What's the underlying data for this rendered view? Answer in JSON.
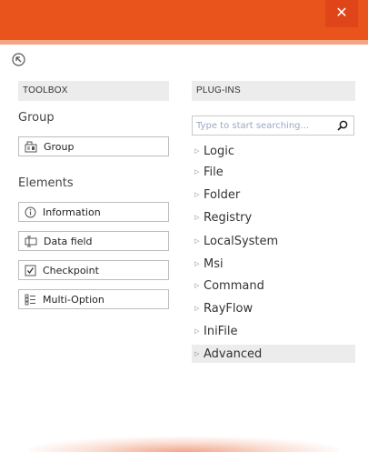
{
  "window": {
    "close_glyph": "✕",
    "accent": "#e8541c"
  },
  "toolbox": {
    "header": "TOOLBOX",
    "group_section_label": "Group",
    "group_items": [
      {
        "label": "Group",
        "icon": "group-icon"
      }
    ],
    "elements_section_label": "Elements",
    "element_items": [
      {
        "label": "Information",
        "icon": "info-icon"
      },
      {
        "label": "Data field",
        "icon": "data-field-icon"
      },
      {
        "label": "Checkpoint",
        "icon": "checkpoint-icon"
      },
      {
        "label": "Multi-Option",
        "icon": "multi-option-icon"
      }
    ]
  },
  "plugins": {
    "header": "PLUG-INS",
    "search_placeholder": "Type to start searching...",
    "items": [
      {
        "label": "Logic"
      },
      {
        "label": "File"
      },
      {
        "label": "Folder"
      },
      {
        "label": "Registry"
      },
      {
        "label": "LocalSystem"
      },
      {
        "label": "Msi"
      },
      {
        "label": "Command"
      },
      {
        "label": "RayFlow"
      },
      {
        "label": "IniFile"
      },
      {
        "label": "Advanced",
        "highlighted": true
      }
    ]
  }
}
